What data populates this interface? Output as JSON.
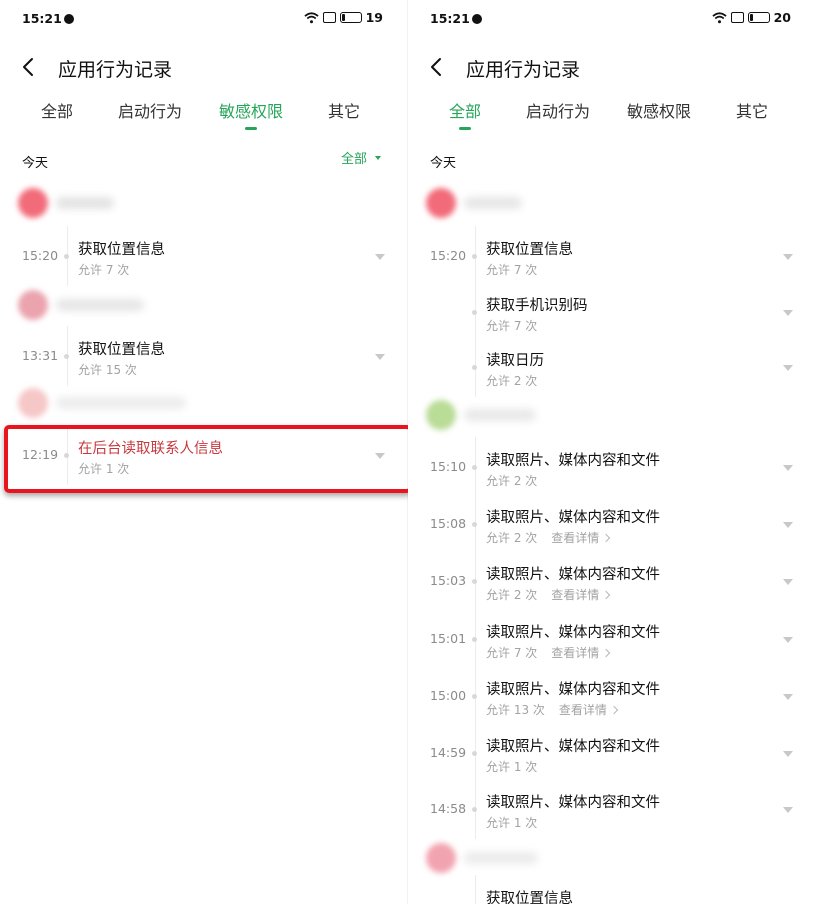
{
  "left": {
    "status": {
      "time": "15:21",
      "battery": "19"
    },
    "header": {
      "title": "应用行为记录"
    },
    "tabs": [
      {
        "label": "全部",
        "active": false
      },
      {
        "label": "启动行为",
        "active": false
      },
      {
        "label": "敏感权限",
        "active": true
      },
      {
        "label": "其它",
        "active": false
      }
    ],
    "today": "今天",
    "filter": "全部",
    "events": [
      {
        "time": "15:20",
        "name": "获取位置信息",
        "sub": "允许 7 次"
      },
      {
        "time": "13:31",
        "name": "获取位置信息",
        "sub": "允许 15 次"
      },
      {
        "time": "12:19",
        "name": "在后台读取联系人信息",
        "sub": "允许 1 次"
      }
    ],
    "colors": {
      "accent": "#26a55a",
      "warning_text": "#c8383f",
      "highlight_border": "#e8141e"
    }
  },
  "right": {
    "status": {
      "time": "15:21",
      "battery": "20"
    },
    "header": {
      "title": "应用行为记录"
    },
    "tabs": [
      {
        "label": "全部",
        "active": true
      },
      {
        "label": "启动行为",
        "active": false
      },
      {
        "label": "敏感权限",
        "active": false
      },
      {
        "label": "其它",
        "active": false
      }
    ],
    "today": "今天",
    "events": [
      {
        "time": "15:20",
        "name": "获取位置信息",
        "sub": "允许 7 次"
      },
      {
        "time": "",
        "name": "获取手机识别码",
        "sub": "允许 7 次"
      },
      {
        "time": "",
        "name": "读取日历",
        "sub": "允许 2 次"
      },
      {
        "time": "15:10",
        "name": "读取照片、媒体内容和文件",
        "sub": "允许 2 次"
      },
      {
        "time": "15:08",
        "name": "读取照片、媒体内容和文件",
        "sub": "允许 2 次",
        "detail": "查看详情"
      },
      {
        "time": "15:03",
        "name": "读取照片、媒体内容和文件",
        "sub": "允许 2 次",
        "detail": "查看详情"
      },
      {
        "time": "15:01",
        "name": "读取照片、媒体内容和文件",
        "sub": "允许 7 次",
        "detail": "查看详情"
      },
      {
        "time": "15:00",
        "name": "读取照片、媒体内容和文件",
        "sub": "允许 13 次",
        "detail": "查看详情"
      },
      {
        "time": "14:59",
        "name": "读取照片、媒体内容和文件",
        "sub": "允许 1 次"
      },
      {
        "time": "14:58",
        "name": "读取照片、媒体内容和文件",
        "sub": "允许 1 次"
      },
      {
        "time": "",
        "name": "获取位置信息",
        "sub": ""
      }
    ],
    "icons": [
      "back-arrow-icon",
      "wifi-icon",
      "battery-icon",
      "dropdown-arrow-icon",
      "chevron-right-icon"
    ]
  }
}
